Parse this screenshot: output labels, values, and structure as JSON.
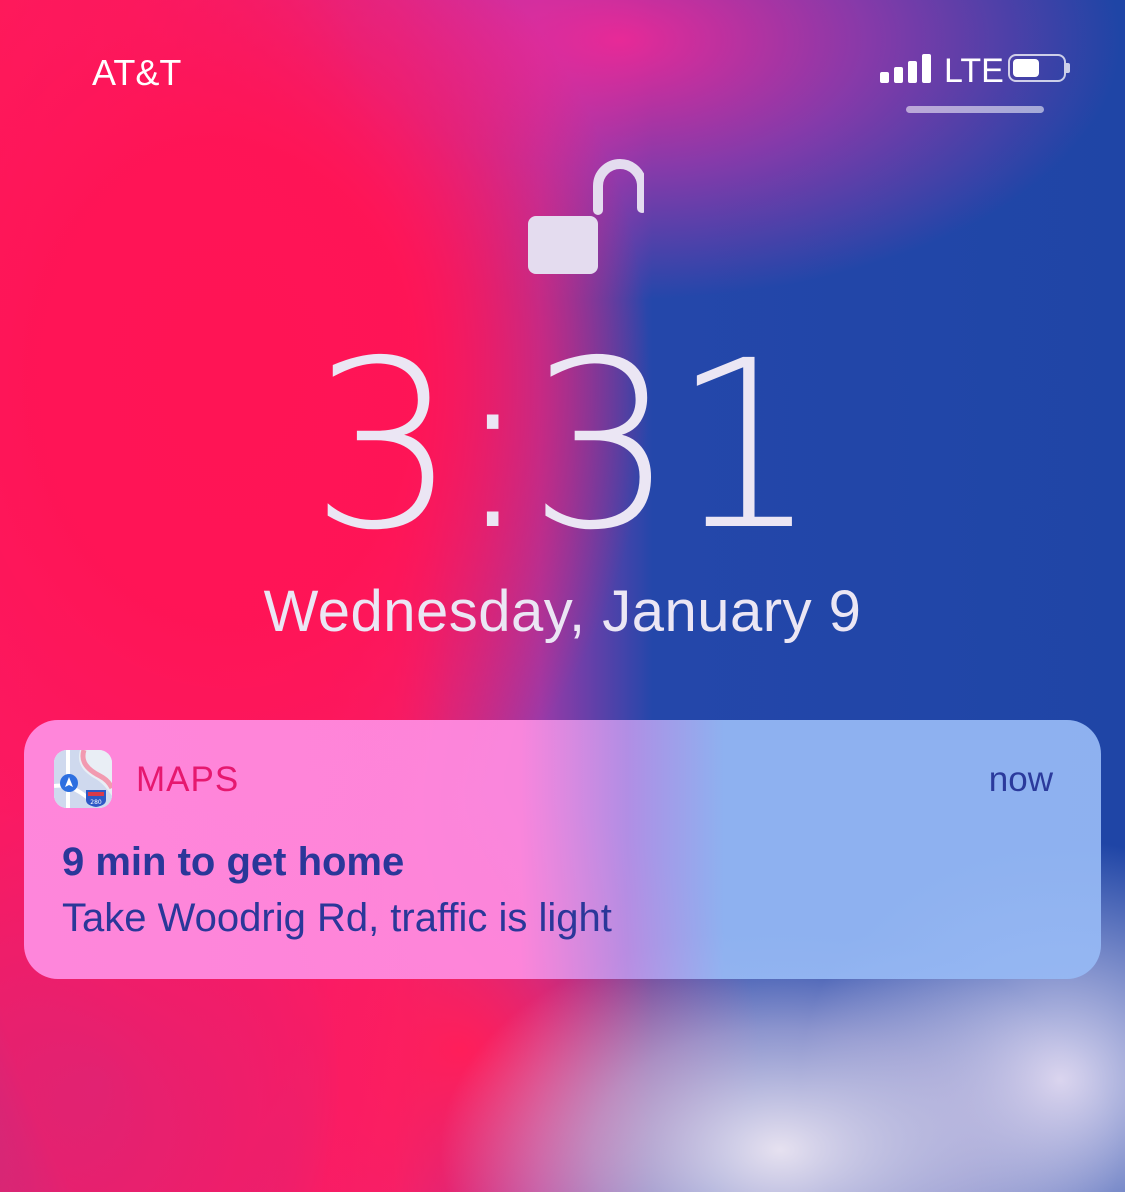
{
  "status_bar": {
    "carrier": "AT&T",
    "network": "LTE",
    "signal_bars": 4,
    "signal_bars_max": 4,
    "battery_level": 0.55,
    "icons": [
      "signal-icon",
      "battery-icon"
    ]
  },
  "lock_screen": {
    "lock_state_icon": "unlocked-padlock-icon",
    "time": "3:31",
    "date": "Wednesday, January 9"
  },
  "notification": {
    "app_icon": "maps-app-icon",
    "app_name": "MAPS",
    "timestamp": "now",
    "title": "9 min to get home",
    "body": "Take Woodrig Rd, traffic is light"
  },
  "colors": {
    "app_name": "#e6186f",
    "notification_text": "#2a3799",
    "clock_text": "#ebe6f4"
  }
}
